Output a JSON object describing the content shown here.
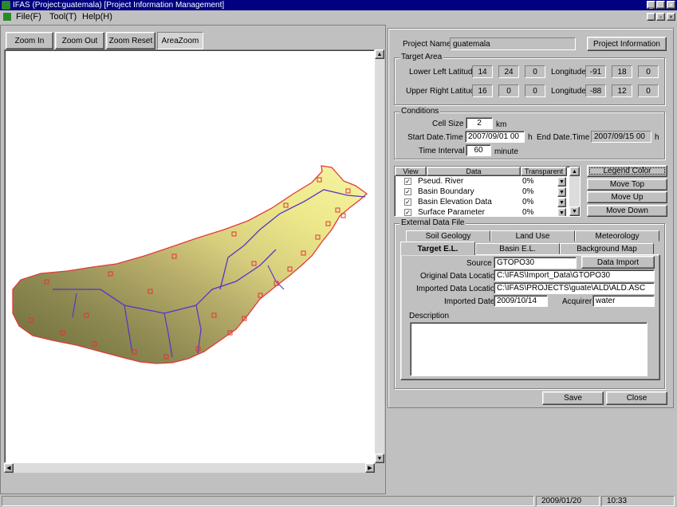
{
  "window": {
    "title": "IFAS (Project:guatemala)  [Project Information Management]"
  },
  "menu": [
    "File(F)",
    "Tool(T)",
    "Help(H)"
  ],
  "toolbar": {
    "zoom_in": "Zoom In",
    "zoom_out": "Zoom Out",
    "zoom_reset": "Zoom Reset",
    "area_zoom": "AreaZoom"
  },
  "project": {
    "name_label": "Project Name",
    "name_value": "guatemala",
    "info_button": "Project Information"
  },
  "target_area": {
    "title": "Target Area",
    "lower_left_lat_label": "Lower Left Latitude",
    "lower_left_lat": [
      "14",
      "24",
      "0"
    ],
    "lower_left_lon_label": "Longitude",
    "lower_left_lon": [
      "-91",
      "18",
      "0"
    ],
    "upper_right_lat_label": "Upper Right Latitude",
    "upper_right_lat": [
      "16",
      "0",
      "0"
    ],
    "upper_right_lon_label": "Longitude",
    "upper_right_lon": [
      "-88",
      "12",
      "0"
    ]
  },
  "conditions": {
    "title": "Conditions",
    "cell_size_label": "Cell Size",
    "cell_size": "2",
    "cell_unit": "km",
    "start_label": "Start Date.Time",
    "start_value": "2007/09/01 00",
    "start_unit": "h",
    "end_label": "End Date.Time",
    "end_value": "2007/09/15 00",
    "end_unit": "h",
    "interval_label": "Time Interval",
    "interval_value": "60",
    "interval_unit": "minute"
  },
  "layers": {
    "headers": [
      "View",
      "Data",
      "Transparent"
    ],
    "rows": [
      {
        "name": "Pseud. River",
        "transparent": "0%"
      },
      {
        "name": "Basin Boundary",
        "transparent": "0%"
      },
      {
        "name": "Basin Elevation Data",
        "transparent": "0%"
      },
      {
        "name": "Surface Parameter",
        "transparent": "0%"
      }
    ],
    "legend_button": "Legend Color",
    "move_top": "Move Top",
    "move_up": "Move Up",
    "move_down": "Move Down"
  },
  "external": {
    "title": "External Data File",
    "tabs_row1": [
      "Soil Geology",
      "Land Use",
      "Meteorology"
    ],
    "tabs_row2": [
      "Target E.L.",
      "Basin E.L.",
      "Background Map"
    ],
    "source_label": "Source",
    "source_value": "GTOPO30",
    "import_button": "Data Import",
    "original_label": "Original Data Location",
    "original_value": "C:\\IFAS\\Import_Data\\GTOPO30",
    "imported_label": "Imported Data Location",
    "imported_value": "C:\\IFAS\\PROJECTS\\guate\\ALD\\ALD.ASC",
    "date_label": "Imported Date",
    "date_value": "2009/10/14",
    "acquirer_label": "Acquirer",
    "acquirer_value": "water",
    "description_label": "Description"
  },
  "actions": {
    "save": "Save",
    "close": "Close"
  },
  "status": {
    "date": "2009/01/20",
    "time": "10:33"
  }
}
